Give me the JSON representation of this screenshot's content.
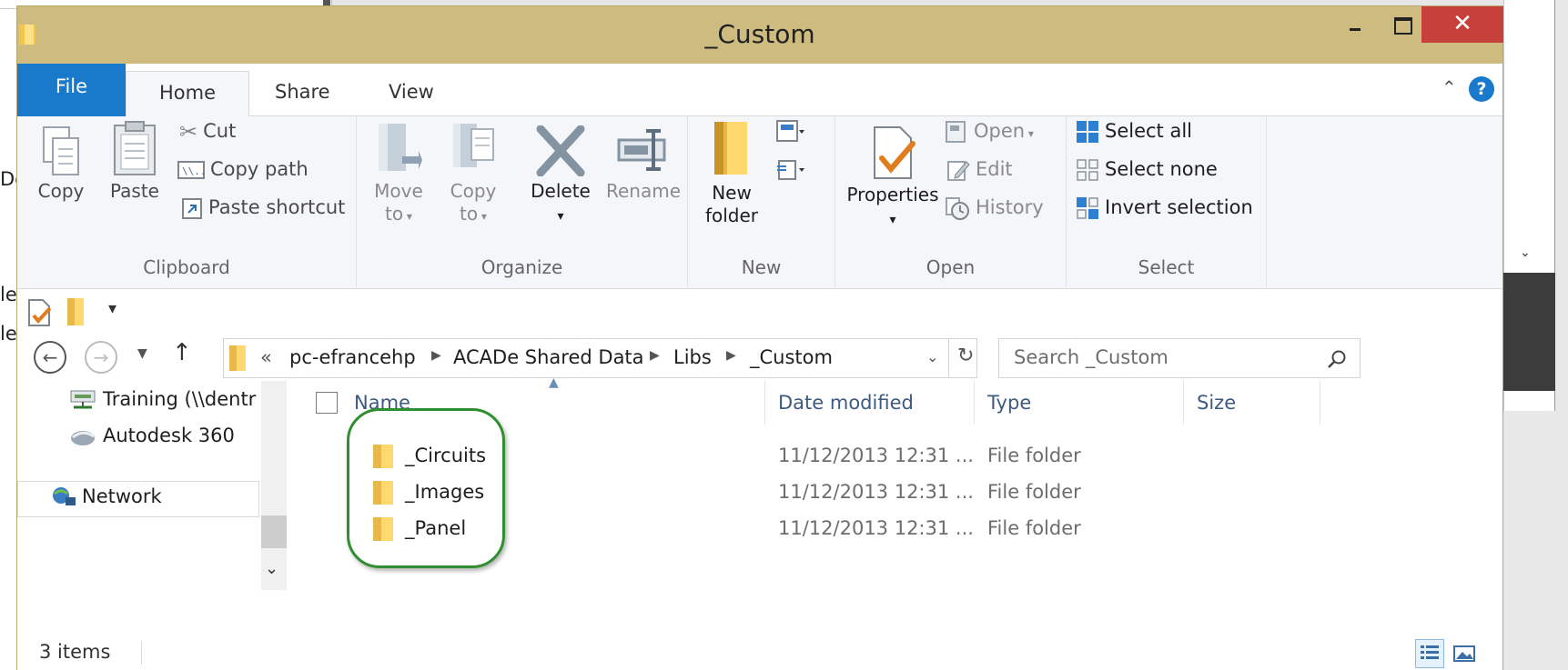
{
  "window": {
    "title": "_Custom"
  },
  "background": {
    "frag1": "De",
    "frag2": "le",
    "frag3": "le",
    "top_text": "Select None"
  },
  "ribbon": {
    "tabs": [
      "File",
      "Home",
      "Share",
      "View"
    ],
    "clipboard": {
      "label": "Clipboard",
      "copy": "Copy",
      "paste": "Paste",
      "cut": "Cut",
      "copy_path": "Copy path",
      "paste_shortcut": "Paste shortcut"
    },
    "organize": {
      "label": "Organize",
      "move_to": "Move",
      "move_to2": "to",
      "copy_to": "Copy",
      "copy_to2": "to",
      "delete": "Delete",
      "rename": "Rename"
    },
    "new": {
      "label": "New",
      "new_folder": "New",
      "new_folder2": "folder"
    },
    "open": {
      "label": "Open",
      "properties": "Properties",
      "open": "Open",
      "edit": "Edit",
      "history": "History"
    },
    "select": {
      "label": "Select",
      "select_all": "Select all",
      "select_none": "Select none",
      "invert_selection": "Invert selection"
    }
  },
  "address": {
    "overflow": "«",
    "crumbs": [
      "pc-efrancehp",
      "ACADe Shared Data",
      "Libs",
      "_Custom"
    ],
    "search_placeholder": "Search _Custom"
  },
  "navpane": {
    "items": [
      "Training (\\\\dentr",
      "Autodesk 360",
      "Network"
    ]
  },
  "columns": {
    "name": "Name",
    "date": "Date modified",
    "type": "Type",
    "size": "Size"
  },
  "files": [
    {
      "name": "_Circuits",
      "date": "11/12/2013 12:31 ...",
      "type": "File folder"
    },
    {
      "name": "_Images",
      "date": "11/12/2013 12:31 ...",
      "type": "File folder"
    },
    {
      "name": "_Panel",
      "date": "11/12/2013 12:31 ...",
      "type": "File folder"
    }
  ],
  "status": {
    "count": "3 items"
  },
  "colors": {
    "title_bar": "#cdbb7f",
    "file_tab": "#1979ca",
    "close": "#c7413b",
    "highlight": "#2f8f2f",
    "folder": "#e8b84a"
  }
}
